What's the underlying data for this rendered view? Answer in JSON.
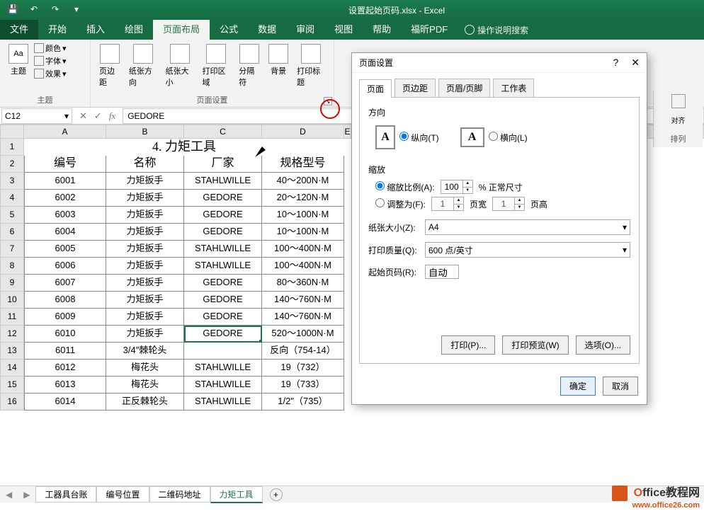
{
  "app": {
    "title": "设置起始页码.xlsx - Excel"
  },
  "qat": [
    "save",
    "undo",
    "redo",
    "customize"
  ],
  "ribbon_tabs": [
    "文件",
    "开始",
    "插入",
    "绘图",
    "页面布局",
    "公式",
    "数据",
    "审阅",
    "视图",
    "帮助",
    "福昕PDF"
  ],
  "ribbon_active": "页面布局",
  "tell_me": "操作说明搜索",
  "groups": {
    "themes": {
      "title": "主题",
      "btn": "主题",
      "opts": [
        "颜色",
        "字体",
        "效果"
      ]
    },
    "page_setup": {
      "title": "页面设置",
      "btns": [
        "页边距",
        "纸张方向",
        "纸张大小",
        "打印区域",
        "分隔符",
        "背景",
        "打印标题"
      ]
    },
    "arrange": {
      "title": "排列",
      "items": [
        "对齐"
      ]
    }
  },
  "namebox": "C12",
  "formula": "GEDORE",
  "col_widths": {
    "A": 116,
    "B": 110,
    "C": 110,
    "D": 116,
    "E": 10,
    "J": 80
  },
  "columns": [
    "A",
    "B",
    "C",
    "D",
    "E",
    "J"
  ],
  "title_row": "4. 力矩工具",
  "headers": [
    "编号",
    "名称",
    "厂家",
    "规格型号"
  ],
  "rows": [
    {
      "r": 3,
      "d": [
        "6001",
        "力矩扳手",
        "STAHLWILLE",
        "40～200N·M"
      ]
    },
    {
      "r": 4,
      "d": [
        "6002",
        "力矩扳手",
        "GEDORE",
        "20～120N·M"
      ]
    },
    {
      "r": 5,
      "d": [
        "6003",
        "力矩扳手",
        "GEDORE",
        "10～100N·M"
      ]
    },
    {
      "r": 6,
      "d": [
        "6004",
        "力矩扳手",
        "GEDORE",
        "10～100N·M"
      ]
    },
    {
      "r": 7,
      "d": [
        "6005",
        "力矩扳手",
        "STAHLWILLE",
        "100～400N·M"
      ]
    },
    {
      "r": 8,
      "d": [
        "6006",
        "力矩扳手",
        "STAHLWILLE",
        "100～400N·M"
      ]
    },
    {
      "r": 9,
      "d": [
        "6007",
        "力矩扳手",
        "GEDORE",
        "80～360N·M"
      ]
    },
    {
      "r": 10,
      "d": [
        "6008",
        "力矩扳手",
        "GEDORE",
        "140～760N·M"
      ]
    },
    {
      "r": 11,
      "d": [
        "6009",
        "力矩扳手",
        "GEDORE",
        "140～760N·M"
      ]
    },
    {
      "r": 12,
      "d": [
        "6010",
        "力矩扳手",
        "GEDORE",
        "520～1000N·M"
      ]
    },
    {
      "r": 13,
      "d": [
        "6011",
        "3/4″棘轮头",
        "",
        "反向（754-14）"
      ]
    },
    {
      "r": 14,
      "d": [
        "6012",
        "梅花头",
        "STAHLWILLE",
        "19（732）"
      ]
    },
    {
      "r": 15,
      "d": [
        "6013",
        "梅花头",
        "STAHLWILLE",
        "19（733）"
      ]
    },
    {
      "r": 16,
      "d": [
        "6014",
        "正反棘轮头",
        "STAHLWILLE",
        "1/2\"（735）"
      ]
    }
  ],
  "sheets": [
    "工器具台账",
    "编号位置",
    "二维码地址",
    "力矩工具"
  ],
  "active_sheet": "力矩工具",
  "dialog": {
    "title": "页面设置",
    "tabs": [
      "页面",
      "页边距",
      "页眉/页脚",
      "工作表"
    ],
    "active_tab": "页面",
    "orient": {
      "label": "方向",
      "portrait": "纵向(T)",
      "landscape": "横向(L)",
      "value": "portrait"
    },
    "zoom": {
      "label": "缩放",
      "ratio_lbl": "缩放比例(A):",
      "ratio": "100",
      "ratio_suffix": "% 正常尺寸",
      "fit_lbl": "调整为(F):",
      "fit_w": "1",
      "fit_w_suffix": "页宽",
      "fit_h": "1",
      "fit_h_suffix": "页高",
      "value": "ratio"
    },
    "paper": {
      "label": "纸张大小(Z):",
      "value": "A4"
    },
    "quality": {
      "label": "打印质量(Q):",
      "value": "600 点/英寸"
    },
    "first_page": {
      "label": "起始页码(R):",
      "value": "自动"
    },
    "btns": {
      "print": "打印(P)...",
      "preview": "打印预览(W)",
      "options": "选项(O)..."
    },
    "ok": "确定",
    "cancel": "取消"
  },
  "watermark": {
    "brand": "Office教程网",
    "url": "www.office26.com"
  }
}
